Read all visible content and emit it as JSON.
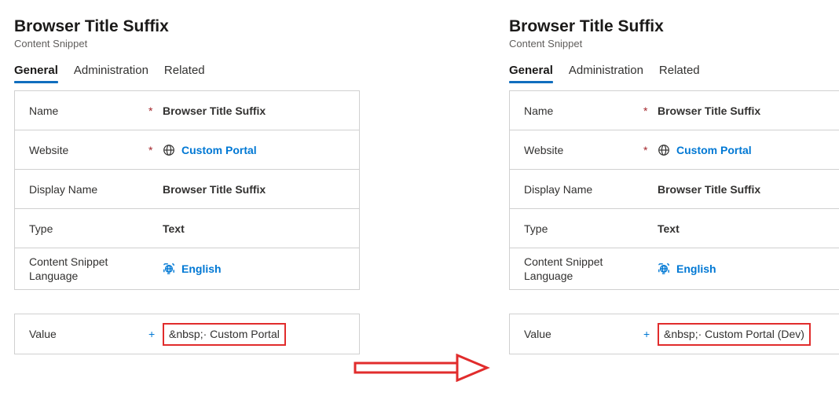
{
  "left": {
    "title": "Browser Title Suffix",
    "subtitle": "Content Snippet",
    "tabs": {
      "general": "General",
      "admin": "Administration",
      "related": "Related"
    },
    "fields": {
      "name_label": "Name",
      "name_value": "Browser Title Suffix",
      "website_label": "Website",
      "website_value": "Custom Portal",
      "display_label": "Display Name",
      "display_value": "Browser Title Suffix",
      "type_label": "Type",
      "type_value": "Text",
      "lang_label": "Content Snippet Language",
      "lang_value": "English",
      "value_label": "Value",
      "value_value": "&nbsp;· Custom Portal"
    }
  },
  "right": {
    "title": "Browser Title Suffix",
    "subtitle": "Content Snippet",
    "tabs": {
      "general": "General",
      "admin": "Administration",
      "related": "Related"
    },
    "fields": {
      "name_label": "Name",
      "name_value": "Browser Title Suffix",
      "website_label": "Website",
      "website_value": "Custom Portal",
      "display_label": "Display Name",
      "display_value": "Browser Title Suffix",
      "type_label": "Type",
      "type_value": "Text",
      "lang_label": "Content Snippet Language",
      "lang_value": "English",
      "value_label": "Value",
      "value_value": "&nbsp;· Custom Portal (Dev)"
    }
  },
  "req_marker": "*",
  "plus_marker": "+"
}
